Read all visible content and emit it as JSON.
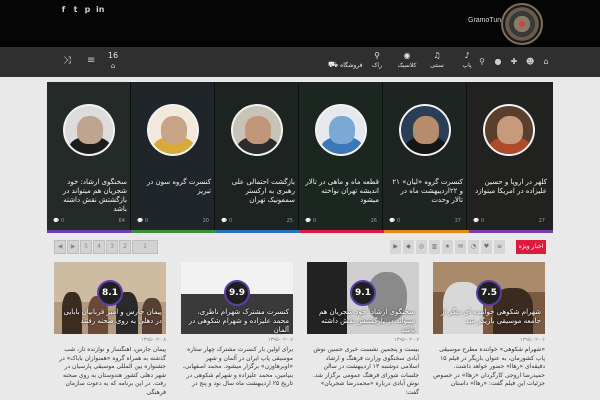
{
  "brand": {
    "name": "GramoTune"
  },
  "social": [
    "f",
    "t",
    "p",
    "in"
  ],
  "date": {
    "day": "16"
  },
  "menu": [
    {
      "label": "فروشگاه",
      "icon": "cart-icon"
    },
    {
      "label": "راک",
      "icon": "guitar-icon"
    },
    {
      "label": "کلاسیک",
      "icon": "disc-icon"
    },
    {
      "label": "سنتی",
      "icon": "music-icon"
    },
    {
      "label": "پاپ",
      "icon": "mic-icon"
    }
  ],
  "slides": [
    {
      "title": "سخنگوی ارشاد: خود شجریان هم میتواند در بازگشتش نقش داشته باشد",
      "views": "64",
      "comments": "0"
    },
    {
      "title": "کنسرت گروه سون در تبریز",
      "views": "20",
      "comments": "0"
    },
    {
      "title": "بازگشت احتمالی علی رهبری به ارکستر سمفونیک تهران",
      "views": "25",
      "comments": "0"
    },
    {
      "title": "قطعه ماه و ماهی در تالار اندیشه تهران نواخته میشود",
      "views": "26",
      "comments": "0"
    },
    {
      "title": "کنسرت گروه «لیان» ۲۱ و ۲۲اردیبهشت ماه در تالار وحدت",
      "views": "37",
      "comments": "0"
    },
    {
      "title": "کلهر در اروپا و حسین علیزاده در امریکا مینوازد",
      "views": "27",
      "comments": "0"
    }
  ],
  "pager": [
    "5",
    "4",
    "3",
    "2",
    "1"
  ],
  "newest_label": "اخبار ویژه",
  "cards": [
    {
      "score": "8.1",
      "title": "پیمان جارس و امیر قربانیان بابایی در دهلی به روی صحنه رفتند",
      "meta": "۱۳۹۵-۰۲-۰۸",
      "excerpt": "پیمان جارس، آهنگساز و نوازنده تار، شب گذشته به همراه گروه «همنوازان باباک» در جشنواره بین المللی موسیقی پارسیان در شهر دهلی کشور هندوستان به روی صحنه رفت. در این برنامه که به دعوت سازمان فرهنگی"
    },
    {
      "score": "9.9",
      "title": "کنسرت مشترک شهرام ناظری، محمد علیزاده و شهرام شکوهی در آلمان",
      "meta": "۱۳۹۵-۰۲-۰۷",
      "excerpt": "برای اولین بار کنسرت مشترک چهار ستاره موسیقی پاپ ایران در آلمان و شهر «اوبرهاوزن» برگزار میشود. محمد اصفهانی، بنیامین، محمد علیزاده و شهرام شکوهی در تاریخ ۲۵ اردیبهشت ماه سال نود و پنج در"
    },
    {
      "score": "9.1",
      "title": "سخنگوی ارشاد: خود شجریان هم میتواند در بازگشتش نقش داشته باشد",
      "meta": "۱۳۹۵-۰۲-۰۷",
      "excerpt": "بیست و پنجمین نشست خبری حسین نوش آبادی سخنگوی وزارت فرهنگ و ارشاد اسلامی دوشنبه ۱۳ اردیبهشت در سالن جلسات شورای فرهنگ عمومی برگزار شد. نوش آبادی درباره «محمدرضا شجریان» گفت:"
    },
    {
      "score": "7.5",
      "title": "شهرام شکوهی خواننده ای دیگر از جامعه موسیقی بازیگر شد",
      "meta": "۱۳۹۵-۰۲-۰۶",
      "excerpt": "«شهرام شکوهی» خواننده مطرح موسیقی پاپ کشورمان، به عنوان بازیگر در فیلم ۱۵ دقیقه‌ای «رهاا» حضور خواهد داشت. حمیدرضا اروجی کارگردان «رهاا» در خصوص جزئیات این فیلم گفت: «رهاا» داستان"
    }
  ]
}
